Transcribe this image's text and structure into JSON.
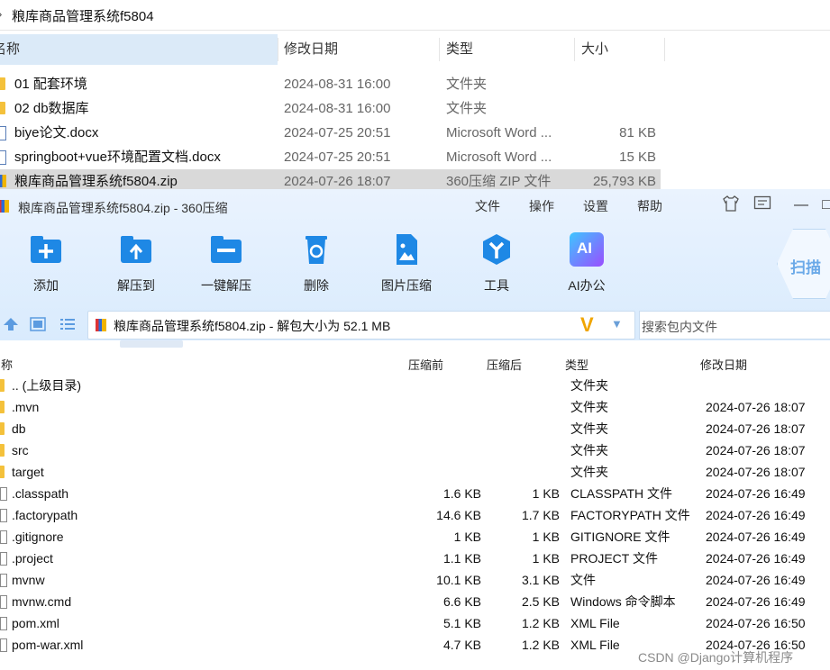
{
  "explorer": {
    "title": "粮库商品管理系统f5804",
    "headers": {
      "name": "名称",
      "modified": "修改日期",
      "type": "类型",
      "size": "大小"
    },
    "rows": [
      {
        "icon": "folder-icon",
        "name": "01 配套环境",
        "modified": "2024-08-31 16:00",
        "type": "文件夹",
        "size": "",
        "selected": false
      },
      {
        "icon": "folder-icon",
        "name": "02 db数据库",
        "modified": "2024-08-31 16:00",
        "type": "文件夹",
        "size": "",
        "selected": false
      },
      {
        "icon": "doc-icon",
        "name": "biye论文.docx",
        "modified": "2024-07-25 20:51",
        "type": "Microsoft Word ...",
        "size": "81 KB",
        "selected": false
      },
      {
        "icon": "doc-icon",
        "name": "springboot+vue环境配置文档.docx",
        "modified": "2024-07-25 20:51",
        "type": "Microsoft Word ...",
        "size": "15 KB",
        "selected": false
      },
      {
        "icon": "zip-icon",
        "name": "粮库商品管理系统f5804.zip",
        "modified": "2024-07-26 18:07",
        "type": "360压缩 ZIP 文件",
        "size": "25,793 KB",
        "selected": true
      }
    ]
  },
  "zipwin": {
    "title": "粮库商品管理系统f5804.zip - 360压缩",
    "menu": [
      "文件",
      "操作",
      "设置",
      "帮助"
    ],
    "tools": [
      {
        "label": "添加",
        "icon": "add-icon"
      },
      {
        "label": "解压到",
        "icon": "extract-to-icon"
      },
      {
        "label": "一键解压",
        "icon": "one-click-extract-icon"
      },
      {
        "label": "删除",
        "icon": "delete-icon"
      },
      {
        "label": "图片压缩",
        "icon": "image-compress-icon"
      },
      {
        "label": "工具",
        "icon": "tools-icon"
      },
      {
        "label": "AI办公",
        "icon": "ai-office-icon"
      }
    ],
    "scan_label": "扫描",
    "ai_badge": "AI",
    "address": "粮库商品管理系统f5804.zip - 解包大小为 52.1 MB",
    "search_placeholder": "搜索包内文件",
    "headers": {
      "name": "名称",
      "before": "压缩前",
      "after": "压缩后",
      "type": "类型",
      "modified": "修改日期"
    },
    "rows": [
      {
        "kind": "folder",
        "name": ".. (上级目录)",
        "before": "",
        "after": "",
        "type": "文件夹",
        "modified": ""
      },
      {
        "kind": "folder",
        "name": ".mvn",
        "before": "",
        "after": "",
        "type": "文件夹",
        "modified": "2024-07-26 18:07"
      },
      {
        "kind": "folder",
        "name": "db",
        "before": "",
        "after": "",
        "type": "文件夹",
        "modified": "2024-07-26 18:07"
      },
      {
        "kind": "folder",
        "name": "src",
        "before": "",
        "after": "",
        "type": "文件夹",
        "modified": "2024-07-26 18:07"
      },
      {
        "kind": "folder",
        "name": "target",
        "before": "",
        "after": "",
        "type": "文件夹",
        "modified": "2024-07-26 18:07"
      },
      {
        "kind": "file",
        "name": ".classpath",
        "before": "1.6 KB",
        "after": "1 KB",
        "type": "CLASSPATH 文件",
        "modified": "2024-07-26 16:49"
      },
      {
        "kind": "file",
        "name": ".factorypath",
        "before": "14.6 KB",
        "after": "1.7 KB",
        "type": "FACTORYPATH 文件",
        "modified": "2024-07-26 16:49"
      },
      {
        "kind": "file",
        "name": ".gitignore",
        "before": "1 KB",
        "after": "1 KB",
        "type": "GITIGNORE 文件",
        "modified": "2024-07-26 16:49"
      },
      {
        "kind": "file",
        "name": ".project",
        "before": "1.1 KB",
        "after": "1 KB",
        "type": "PROJECT 文件",
        "modified": "2024-07-26 16:49"
      },
      {
        "kind": "file",
        "name": "mvnw",
        "before": "10.1 KB",
        "after": "3.1 KB",
        "type": "文件",
        "modified": "2024-07-26 16:49"
      },
      {
        "kind": "file",
        "name": "mvnw.cmd",
        "before": "6.6 KB",
        "after": "2.5 KB",
        "type": "Windows 命令脚本",
        "modified": "2024-07-26 16:49"
      },
      {
        "kind": "file",
        "name": "pom.xml",
        "before": "5.1 KB",
        "after": "1.2 KB",
        "type": "XML File",
        "modified": "2024-07-26 16:50"
      },
      {
        "kind": "file",
        "name": "pom-war.xml",
        "before": "4.7 KB",
        "after": "1.2 KB",
        "type": "XML File",
        "modified": "2024-07-26 16:50"
      }
    ]
  },
  "watermark": "CSDN @Django计算机程序",
  "colors": {
    "accent": "#2b8de0",
    "folder": "#f4c13b",
    "selected_row": "#d9d9d9",
    "toolbar_bg": "#e3effd"
  }
}
